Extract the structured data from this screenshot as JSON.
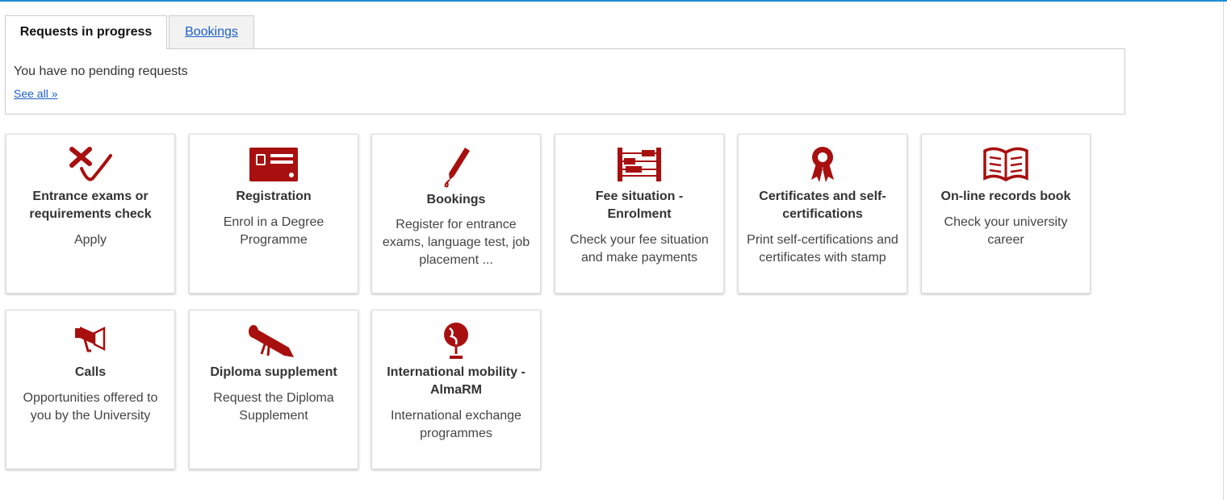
{
  "tabs": [
    {
      "label": "Requests in progress",
      "active": true
    },
    {
      "label": "Bookings",
      "active": false
    }
  ],
  "panel": {
    "message": "You have no pending requests",
    "link": "See all »"
  },
  "cards": [
    {
      "title": "Entrance exams or requirements check",
      "description": "Apply",
      "icon": "check-mark-icon"
    },
    {
      "title": "Registration",
      "description": "Enrol in a Degree Programme",
      "icon": "id-card-icon"
    },
    {
      "title": "Bookings",
      "description": "Register for entrance exams, language test, job placement ...",
      "icon": "pen-icon"
    },
    {
      "title": "Fee situation - Enrolment",
      "description": "Check your fee situation and make payments",
      "icon": "abacus-icon"
    },
    {
      "title": "Certificates and self-certifications",
      "description": "Print self-certifications and certificates with stamp",
      "icon": "ribbon-icon"
    },
    {
      "title": "On-line records book",
      "description": "Check your university career",
      "icon": "open-book-icon"
    },
    {
      "title": "Calls",
      "description": "Opportunities offered to you by the University",
      "icon": "megaphone-icon"
    },
    {
      "title": "Diploma supplement",
      "description": "Request the Diploma Supplement",
      "icon": "diploma-scroll-icon"
    },
    {
      "title": "International mobility - AlmaRM",
      "description": "International exchange programmes",
      "icon": "globe-icon"
    }
  ],
  "colors": {
    "accent": "#1d8fd6",
    "icon": "#a80f0f",
    "link": "#1a5fc7"
  }
}
